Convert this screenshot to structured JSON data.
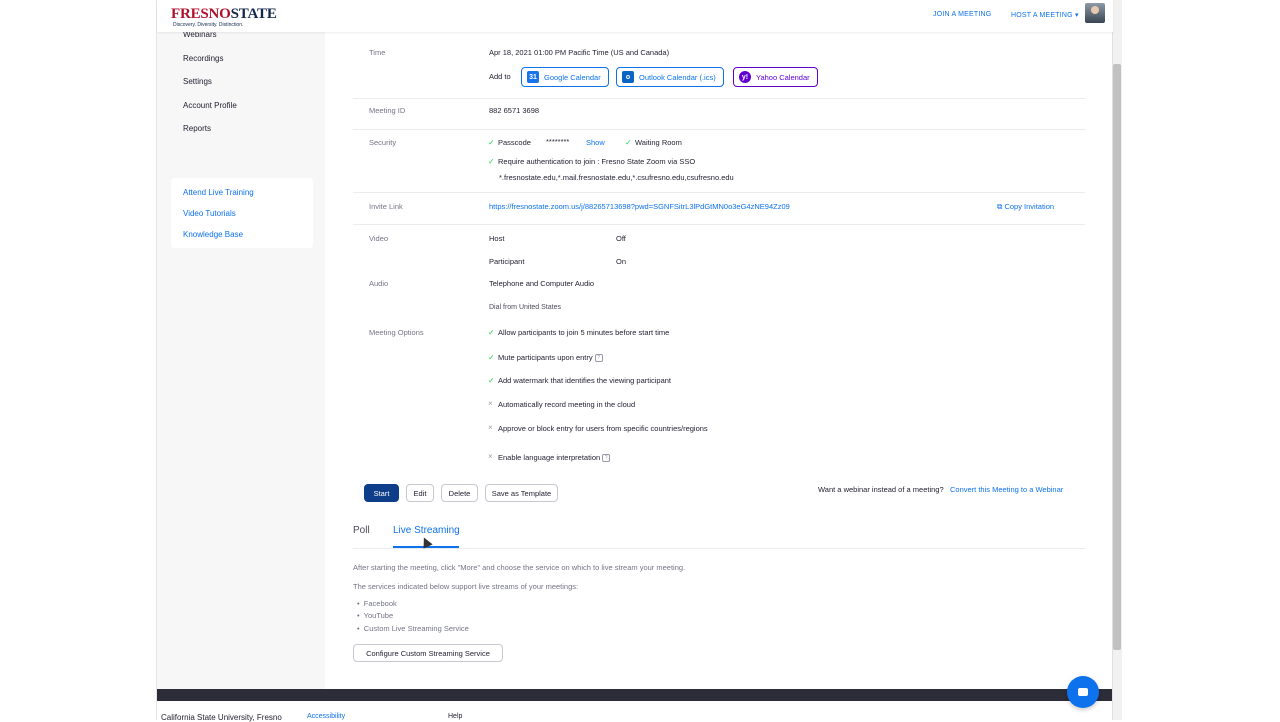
{
  "brand": {
    "logo_main": "FRESNO",
    "logo_state": "STATE",
    "logo_tagline": "Discovery. Diversity. Distinction."
  },
  "top_nav": {
    "join": "JOIN A MEETING",
    "host": "HOST A MEETING ▾"
  },
  "sidebar": {
    "items": [
      "Webinars",
      "Recordings",
      "Settings",
      "Account Profile",
      "Reports"
    ],
    "help_links": [
      "Attend Live Training",
      "Video Tutorials",
      "Knowledge Base"
    ]
  },
  "meeting": {
    "time_label": "Time",
    "time_value": "Apr 18, 2021 01:00 PM Pacific Time (US and Canada)",
    "add_to_label": "Add to",
    "calendars": [
      {
        "label": "Google Calendar",
        "icon": "31",
        "color": "#1a73e8"
      },
      {
        "label": "Outlook Calendar (.ics)",
        "icon": "o",
        "color": "#0a64c4"
      },
      {
        "label": "Yahoo Calendar",
        "icon": "y!",
        "color": "#6001d2"
      }
    ],
    "id_label": "Meeting ID",
    "id_value": "882 6571 3698",
    "security_label": "Security",
    "passcode_label": "Passcode",
    "passcode_value": "********",
    "show_label": "Show",
    "waiting_room": "Waiting Room",
    "auth_text": "Require authentication to join : Fresno State Zoom via SSO",
    "auth_domains": "*.fresnostate.edu,*.mail.fresnostate.edu,*.csufresno.edu,csufresno.edu",
    "invite_label": "Invite Link",
    "invite_url": "https://fresnostate.zoom.us/j/88265713698?pwd=SGNFSitrL3lPdGtMN0o3eG4zNE94Zz09",
    "copy_invitation": "Copy Invitation",
    "video_label": "Video",
    "host_label": "Host",
    "host_value": "Off",
    "participant_label": "Participant",
    "participant_value": "On",
    "audio_label": "Audio",
    "audio_value": "Telephone and Computer Audio",
    "dial_from": "Dial from United States",
    "options_label": "Meeting Options",
    "options": [
      {
        "text": "Allow participants to join  5 minutes before start time",
        "enabled": true
      },
      {
        "text": "Mute participants upon entry",
        "enabled": true
      },
      {
        "text": "Add watermark that identifies the viewing participant",
        "enabled": true
      },
      {
        "text": "Automatically record meeting in the cloud",
        "enabled": false
      },
      {
        "text": "Approve or block entry for users from specific countries/regions",
        "enabled": false
      },
      {
        "text": "Enable language interpretation",
        "enabled": false
      }
    ]
  },
  "actions": {
    "start": "Start",
    "edit": "Edit",
    "delete": "Delete",
    "save_template": "Save as Template",
    "webinar_question": "Want a webinar instead of a meeting?",
    "convert_link": "Convert this Meeting to a Webinar"
  },
  "tabs": [
    "Poll",
    "Live Streaming"
  ],
  "live_streaming": {
    "intro": "After starting the meeting, click \"More\" and choose the service on which to live stream your meeting.",
    "services_intro": "The services indicated below support live streams of your meetings:",
    "services": [
      "Facebook",
      "YouTube",
      "Custom Live Streaming Service"
    ],
    "configure_button": "Configure Custom Streaming Service"
  },
  "footer": {
    "university": "California State University, Fresno",
    "accessibility": "Accessibility",
    "help": "Help"
  }
}
